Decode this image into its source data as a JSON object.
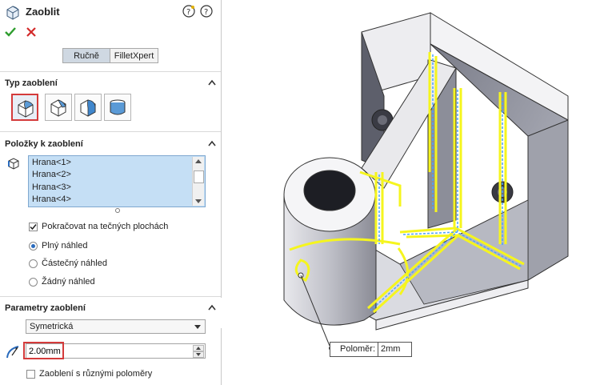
{
  "panel": {
    "title": "Zaoblit",
    "title_icon": "fillet-feature-icon",
    "help_icons": [
      "whats-new-help-icon",
      "help-icon"
    ],
    "ok_icon": "checkmark-icon",
    "cancel_icon": "close-x-icon",
    "mode_tabs": [
      {
        "label": "Ručně",
        "active": true
      },
      {
        "label": "FilletXpert",
        "active": false
      }
    ]
  },
  "fillet_type": {
    "title": "Typ zaoblení",
    "types": [
      {
        "name": "constant-size-fillet-icon",
        "selected": true
      },
      {
        "name": "variable-size-fillet-icon",
        "selected": false
      },
      {
        "name": "face-fillet-icon",
        "selected": false
      },
      {
        "name": "full-round-fillet-icon",
        "selected": false
      }
    ]
  },
  "items": {
    "title": "Položky k zaoblení",
    "list_icon": "edge-selection-icon",
    "entries": [
      "Hrana<1>",
      "Hrana<2>",
      "Hrana<3>",
      "Hrana<4>"
    ],
    "tangent_propagation": {
      "label": "Pokračovat na tečných plochách",
      "checked": true
    },
    "preview_options": [
      {
        "label": "Plný náhled",
        "selected": true
      },
      {
        "label": "Částečný náhled",
        "selected": false
      },
      {
        "label": "Žádný náhled",
        "selected": false
      }
    ]
  },
  "parameters": {
    "title": "Parametry zaoblení",
    "method": "Symetrická",
    "radius_icon": "radius-icon",
    "radius_value": "2.00mm",
    "multi_radius": {
      "label": "Zaoblení s různými poloměry",
      "checked": false
    }
  },
  "viewport": {
    "callout_label": "Poloměr:",
    "callout_value": "2mm",
    "highlight_color": "#f5f51e",
    "edge_color": "#4aa3ff"
  }
}
